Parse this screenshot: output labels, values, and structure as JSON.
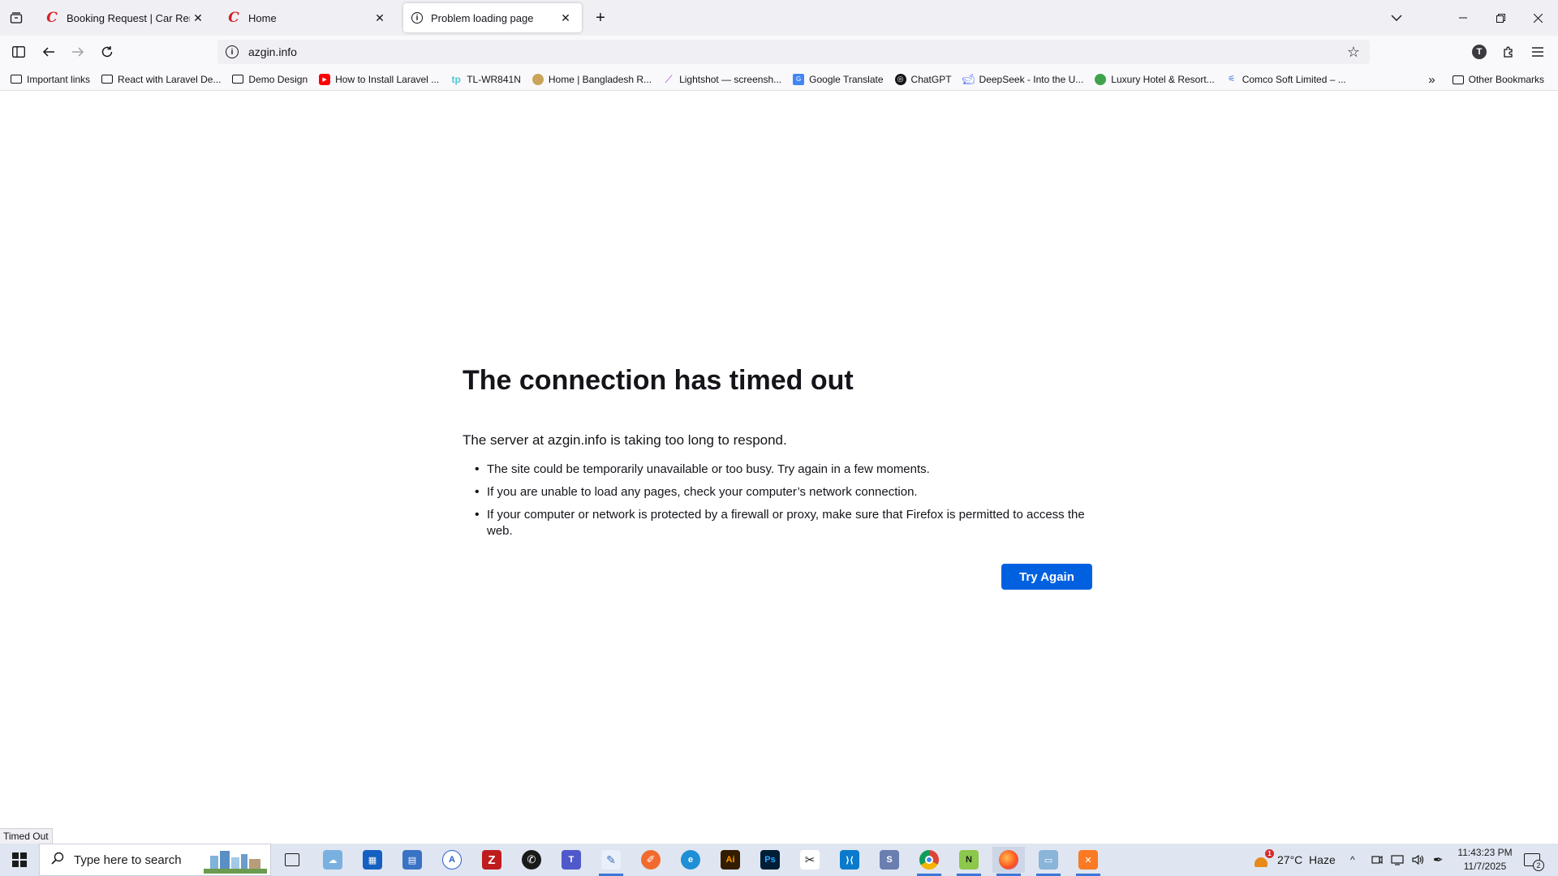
{
  "tabs": [
    {
      "title": "Booking Request | Car Rental Pl",
      "favicon": "C",
      "active": false
    },
    {
      "title": "Home",
      "favicon": "C",
      "active": false
    },
    {
      "title": "Problem loading page",
      "favicon": "info-icon",
      "active": true
    }
  ],
  "url": "azgin.info",
  "bookmarks": [
    {
      "label": "Important links",
      "icon": "folder-icon"
    },
    {
      "label": "React with Laravel De...",
      "icon": "folder-icon"
    },
    {
      "label": "Demo Design",
      "icon": "folder-icon"
    },
    {
      "label": "How to Install Laravel ...",
      "icon": "youtube-icon"
    },
    {
      "label": "TL-WR841N",
      "icon": "tplink-icon"
    },
    {
      "label": "Home | Bangladesh R...",
      "icon": "bangladesh-icon"
    },
    {
      "label": "Lightshot — screensh...",
      "icon": "lightshot-icon"
    },
    {
      "label": "Google Translate",
      "icon": "translate-icon"
    },
    {
      "label": "ChatGPT",
      "icon": "chatgpt-icon"
    },
    {
      "label": "DeepSeek - Into the U...",
      "icon": "deepseek-icon"
    },
    {
      "label": "Luxury Hotel & Resort...",
      "icon": "hotel-icon"
    },
    {
      "label": "Comco Soft Limited – ...",
      "icon": "comco-icon"
    }
  ],
  "other_bookmarks": "Other Bookmarks",
  "error": {
    "title": "The connection has timed out",
    "description": "The server at azgin.info is taking too long to respond.",
    "tips": [
      "The site could be temporarily unavailable or too busy. Try again in a few moments.",
      "If you are unable to load any pages, check your computer’s network connection.",
      "If your computer or network is protected by a firewall or proxy, make sure that Firefox is permitted to access the web."
    ],
    "button": "Try Again"
  },
  "status_text": "Timed Out",
  "taskbar": {
    "search_placeholder": "Type here to search",
    "weather": "27°C  Haze",
    "weather_badge": "1",
    "time": "11:43:23 PM",
    "date": "11/7/2025",
    "notification_count": "2"
  },
  "colors": {
    "accent": "#0061e0",
    "tabstrip": "#f0f0f4",
    "taskbar": "#dfe6f1"
  }
}
